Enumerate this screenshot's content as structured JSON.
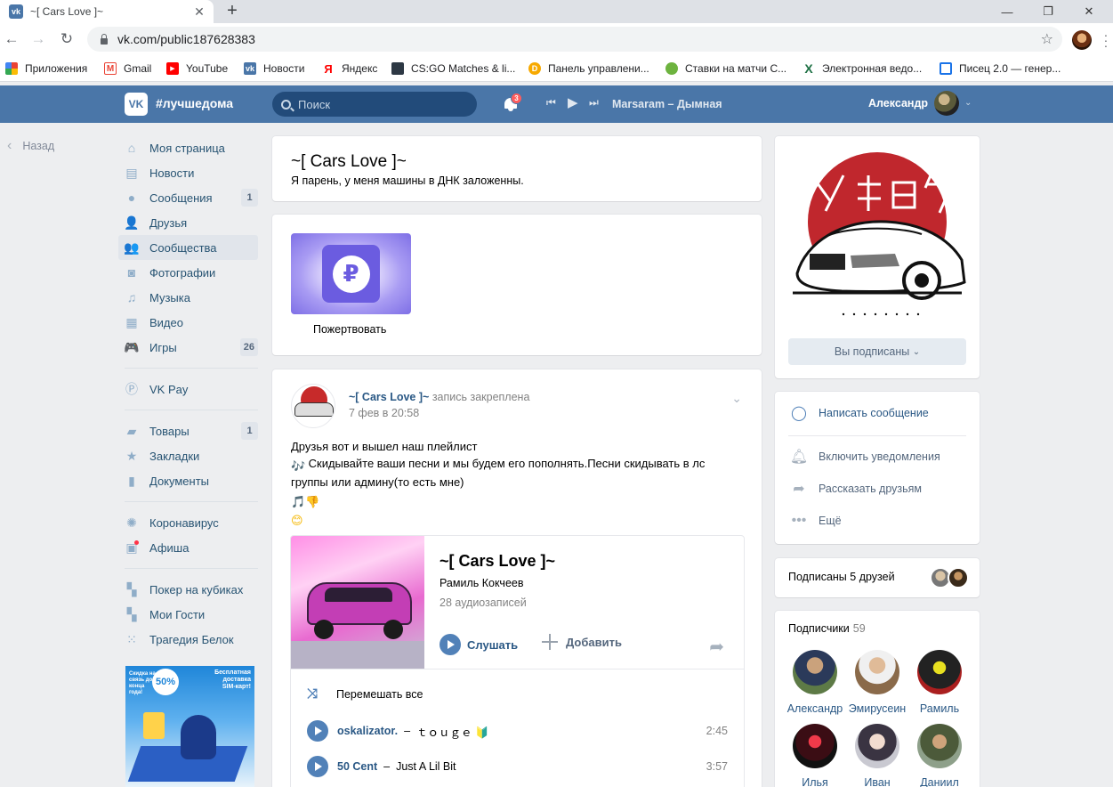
{
  "browser": {
    "tab_title": "~[ Cars Love ]~",
    "tab_favicon": "vk",
    "url": "vk.com/public187628383",
    "bookmarks": [
      {
        "label": "Приложения",
        "icon": "apps-grid-icon",
        "color": "#ea4335"
      },
      {
        "label": "Gmail",
        "icon": "gmail-icon",
        "color": "#ea4335"
      },
      {
        "label": "YouTube",
        "icon": "youtube-icon",
        "color": "#ff0000"
      },
      {
        "label": "Новости",
        "icon": "vk-icon",
        "color": "#4a76a8"
      },
      {
        "label": "Яндекс",
        "icon": "yandex-icon",
        "color": "#ff0000"
      },
      {
        "label": "CS:GO Matches & li...",
        "icon": "hltv-icon",
        "color": "#2d3844"
      },
      {
        "label": "Панель управлени...",
        "icon": "dashboard-icon",
        "color": "#f7a900"
      },
      {
        "label": "Ставки на матчи С...",
        "icon": "bet-icon",
        "color": "#6db33f"
      },
      {
        "label": "Электронная ведо...",
        "icon": "excel-icon",
        "color": "#1d7044"
      },
      {
        "label": "Писец 2.0 — генер...",
        "icon": "pisec-icon",
        "color": "#1a73e8"
      }
    ]
  },
  "vk": {
    "logo": "VK",
    "slogan": "#лучшедома",
    "search_placeholder": "Поиск",
    "notif_count": "3",
    "now_playing": "Marsaram – Дымная",
    "user_name": "Александр",
    "accent": "#4a76a8"
  },
  "left_menu": {
    "back": "Назад",
    "group1": [
      {
        "label": "Моя страница",
        "icon": "home-icon",
        "count": ""
      },
      {
        "label": "Новости",
        "icon": "news-icon",
        "count": ""
      },
      {
        "label": "Сообщения",
        "icon": "messages-icon",
        "count": "1"
      },
      {
        "label": "Друзья",
        "icon": "friends-icon",
        "count": ""
      },
      {
        "label": "Сообщества",
        "icon": "communities-icon",
        "count": "",
        "active": true
      },
      {
        "label": "Фотографии",
        "icon": "camera-icon",
        "count": ""
      },
      {
        "label": "Музыка",
        "icon": "music-icon",
        "count": ""
      },
      {
        "label": "Видео",
        "icon": "video-icon",
        "count": ""
      },
      {
        "label": "Игры",
        "icon": "games-icon",
        "count": "26"
      }
    ],
    "group2": [
      {
        "label": "VK Pay",
        "icon": "vkpay-icon",
        "count": ""
      }
    ],
    "group3": [
      {
        "label": "Товары",
        "icon": "bag-icon",
        "count": "1"
      },
      {
        "label": "Закладки",
        "icon": "star-icon",
        "count": ""
      },
      {
        "label": "Документы",
        "icon": "document-icon",
        "count": ""
      }
    ],
    "group4": [
      {
        "label": "Коронавирус",
        "icon": "virus-icon",
        "count": ""
      },
      {
        "label": "Афиша",
        "icon": "afisha-icon",
        "count": ""
      }
    ],
    "group5": [
      {
        "label": "Покер на кубиках",
        "icon": "app-icon",
        "count": ""
      },
      {
        "label": "Мои Гости",
        "icon": "app-icon",
        "count": ""
      },
      {
        "label": "Трагедия Белок",
        "icon": "app-grid-icon",
        "count": ""
      }
    ],
    "ad": {
      "discount_text": "Скидка на связь до конца года!",
      "discount_pct": "50%",
      "delivery_text": "Бесплатная доставка SIM-карт!"
    }
  },
  "group": {
    "name": "~[ Cars Love ]~",
    "status": "Я парень, у меня машины в ДНК заложенны."
  },
  "donate": {
    "label": "Пожертвовать",
    "symbol": "₽"
  },
  "post": {
    "author": "~[ Cars Love ]~",
    "action": "запись закреплена",
    "date": "7 фев в 20:58",
    "line1": "Друзья вот и вышел наш плейлист",
    "line2": "Скидывайте ваши песни и мы будем его пополнять.Песни скидывать в лс группы или админу(то есть мне)",
    "playlist": {
      "title": "~[ Cars Love ]~",
      "artist": "Рамиль Кокчеев",
      "count": "28 аудиозаписей",
      "listen": "Слушать",
      "add": "Добавить",
      "shuffle": "Перемешать все",
      "tracks": [
        {
          "artist": "oskalizator.",
          "name": "ｔｏｕｇｅ 🔰",
          "duration": "2:45"
        },
        {
          "artist": "50 Cent",
          "name": "Just A Lil Bit",
          "duration": "3:57"
        }
      ]
    }
  },
  "right": {
    "subscribed": "Вы подписаны",
    "actions": [
      {
        "label": "Написать сообщение",
        "icon": "message-bubble-icon",
        "accent": true
      },
      {
        "label": "Включить уведомления",
        "icon": "bell-icon",
        "accent": false
      },
      {
        "label": "Рассказать друзьям",
        "icon": "share-arrow-icon",
        "accent": false
      },
      {
        "label": "Ещё",
        "icon": "more-dots-icon",
        "accent": false
      }
    ],
    "friends_subscribed": "Подписаны 5 друзей",
    "subscribers_label": "Подписчики",
    "subscribers_count": "59",
    "members": [
      {
        "name": "Александр"
      },
      {
        "name": "Эмирусеин"
      },
      {
        "name": "Рамиль"
      },
      {
        "name": "Илья"
      },
      {
        "name": "Иван"
      },
      {
        "name": "Даниил"
      }
    ]
  }
}
